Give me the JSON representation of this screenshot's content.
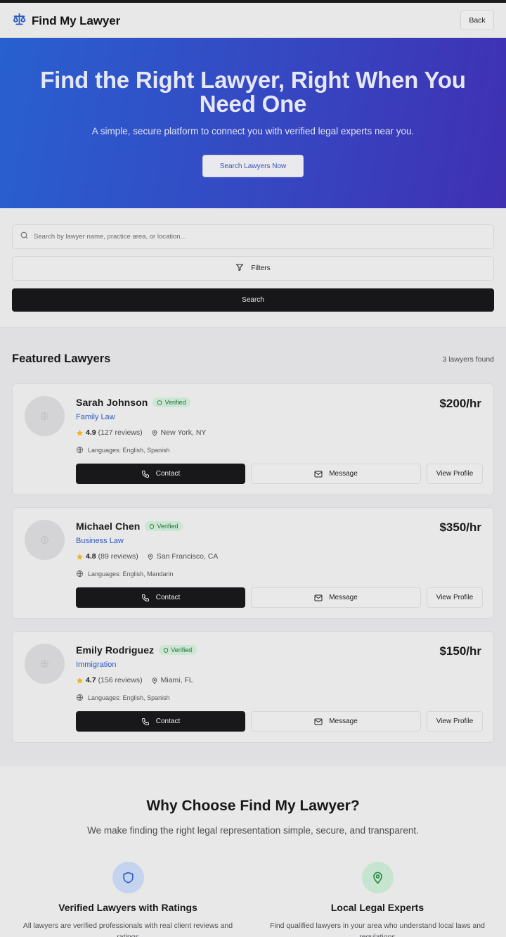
{
  "header": {
    "brand": "Find My Lawyer",
    "back_label": "Back"
  },
  "hero": {
    "title": "Find the Right Lawyer, Right When You Need One",
    "subtitle": "A simple, secure platform to connect you with verified legal experts near you.",
    "cta_label": "Search Lawyers Now"
  },
  "search": {
    "placeholder": "Search by lawyer name, practice area, or location...",
    "value": "",
    "filters_label": "Filters",
    "search_label": "Search"
  },
  "featured": {
    "title": "Featured Lawyers",
    "count": "3 lawyers found",
    "lawyers": [
      {
        "name": "Sarah Johnson",
        "badge": "Verified",
        "practice": "Family Law",
        "rating": "4.9",
        "reviews": "(127 reviews)",
        "location": "New York, NY",
        "languages": "Languages: English, Spanish",
        "rate": "$200/hr",
        "contact_label": "Contact",
        "message_label": "Message",
        "profile_label": "View Profile"
      },
      {
        "name": "Michael Chen",
        "badge": "Verified",
        "practice": "Business Law",
        "rating": "4.8",
        "reviews": "(89 reviews)",
        "location": "San Francisco, CA",
        "languages": "Languages: English, Mandarin",
        "rate": "$350/hr",
        "contact_label": "Contact",
        "message_label": "Message",
        "profile_label": "View Profile"
      },
      {
        "name": "Emily Rodriguez",
        "badge": "Verified",
        "practice": "Immigration",
        "rating": "4.7",
        "reviews": "(156 reviews)",
        "location": "Miami, FL",
        "languages": "Languages: English, Spanish",
        "rate": "$150/hr",
        "contact_label": "Contact",
        "message_label": "Message",
        "profile_label": "View Profile"
      }
    ]
  },
  "why": {
    "title": "Why Choose Find My Lawyer?",
    "subtitle": "We make finding the right legal representation simple, secure, and transparent.",
    "features": [
      {
        "icon": "shield-icon",
        "title": "Verified Lawyers with Ratings",
        "desc": "All lawyers are verified professionals with real client reviews and ratings"
      },
      {
        "icon": "map-pin-icon",
        "title": "Local Legal Experts",
        "desc": "Find qualified lawyers in your area who understand local laws and regulations"
      }
    ]
  },
  "colors": {
    "hero_gradient_start": "#2860cf",
    "hero_gradient_end": "#3f30b2",
    "practice_blue": "#2e58c3",
    "verified_green": "#23713d",
    "star_gold": "#f0b323",
    "primary_dark": "#18181a"
  }
}
